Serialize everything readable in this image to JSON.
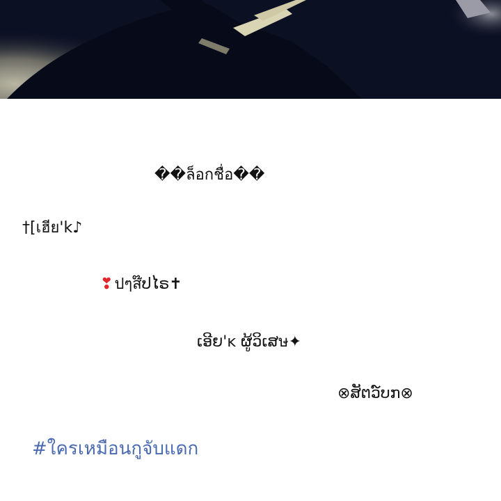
{
  "post": {
    "heading": "��ล็อกชื่อ��",
    "names": [
      "†[เฮีย'k♪",
      "ปๆส໊ປໄຣ✝",
      "ເອີຍ'ĸ ຜູ້ວິເສษ✦",
      "⊗ສັຕວ໌ບກ⊗"
    ],
    "heart_icon": "heart-exclamation-icon",
    "heart_color": "#e3262e",
    "hashtag": "#ใครเหมือนกูจับแดก",
    "hashtag_color": "#4a6ab0"
  },
  "photo": {
    "description_icon": "hand-photo"
  }
}
